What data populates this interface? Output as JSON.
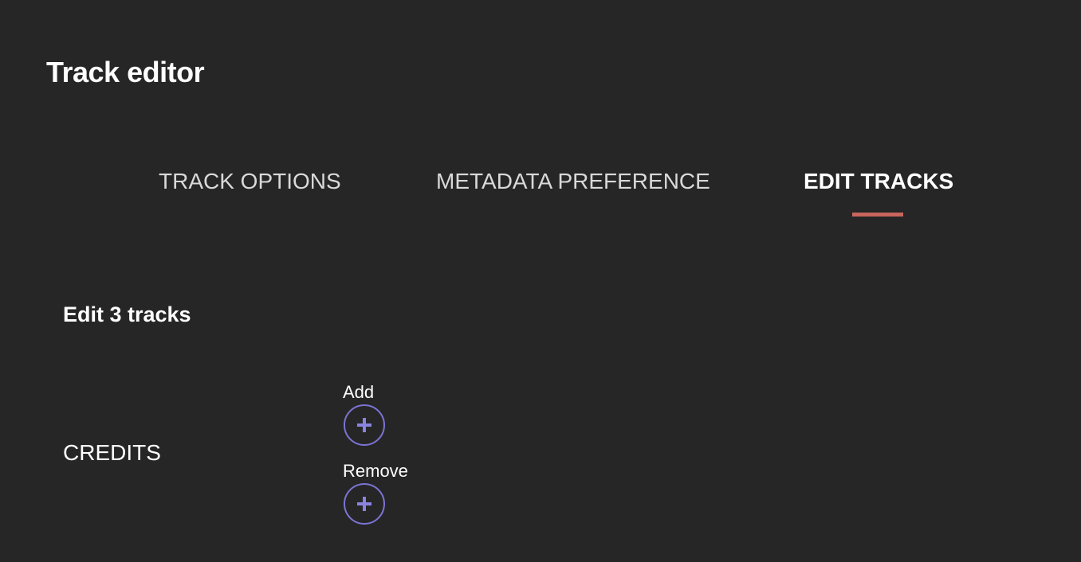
{
  "header": {
    "title": "Track editor"
  },
  "tabs": [
    {
      "label": "TRACK OPTIONS",
      "active": false
    },
    {
      "label": "METADATA PREFERENCE",
      "active": false
    },
    {
      "label": "EDIT TRACKS",
      "active": true
    }
  ],
  "edit": {
    "heading": "Edit 3 tracks",
    "credits_label": "CREDITS",
    "add_label": "Add",
    "remove_label": "Remove"
  },
  "colors": {
    "background": "#262626",
    "active_tab_indicator": "#c8665d",
    "button_accent": "#7b74d4"
  },
  "icons": {
    "add": "plus-icon",
    "remove": "plus-icon"
  }
}
